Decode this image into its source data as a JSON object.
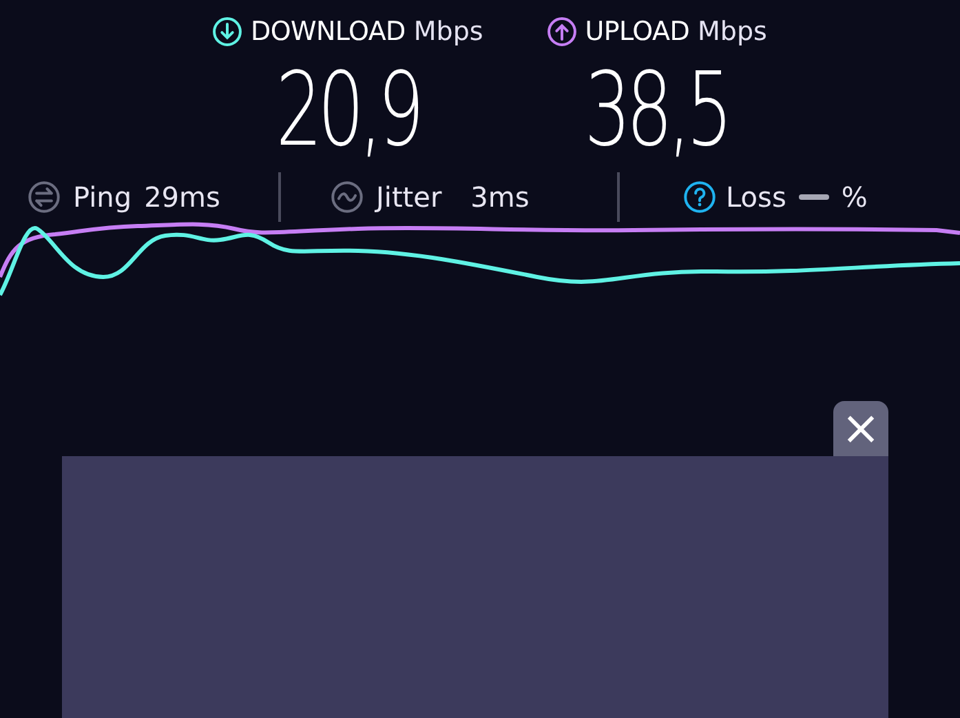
{
  "results": [
    {
      "kind": "download",
      "label": "DOWNLOAD",
      "unit": "Mbps",
      "value": "20,9"
    },
    {
      "kind": "upload",
      "label": "UPLOAD",
      "unit": "Mbps",
      "value": "38,5"
    }
  ],
  "stats": [
    {
      "kind": "ping",
      "label": "Ping",
      "value": "29ms"
    },
    {
      "kind": "jitter",
      "label": "Jitter",
      "value": "3ms"
    },
    {
      "kind": "loss",
      "label": "Loss",
      "value": "%"
    }
  ],
  "ad": {
    "close": "×"
  }
}
